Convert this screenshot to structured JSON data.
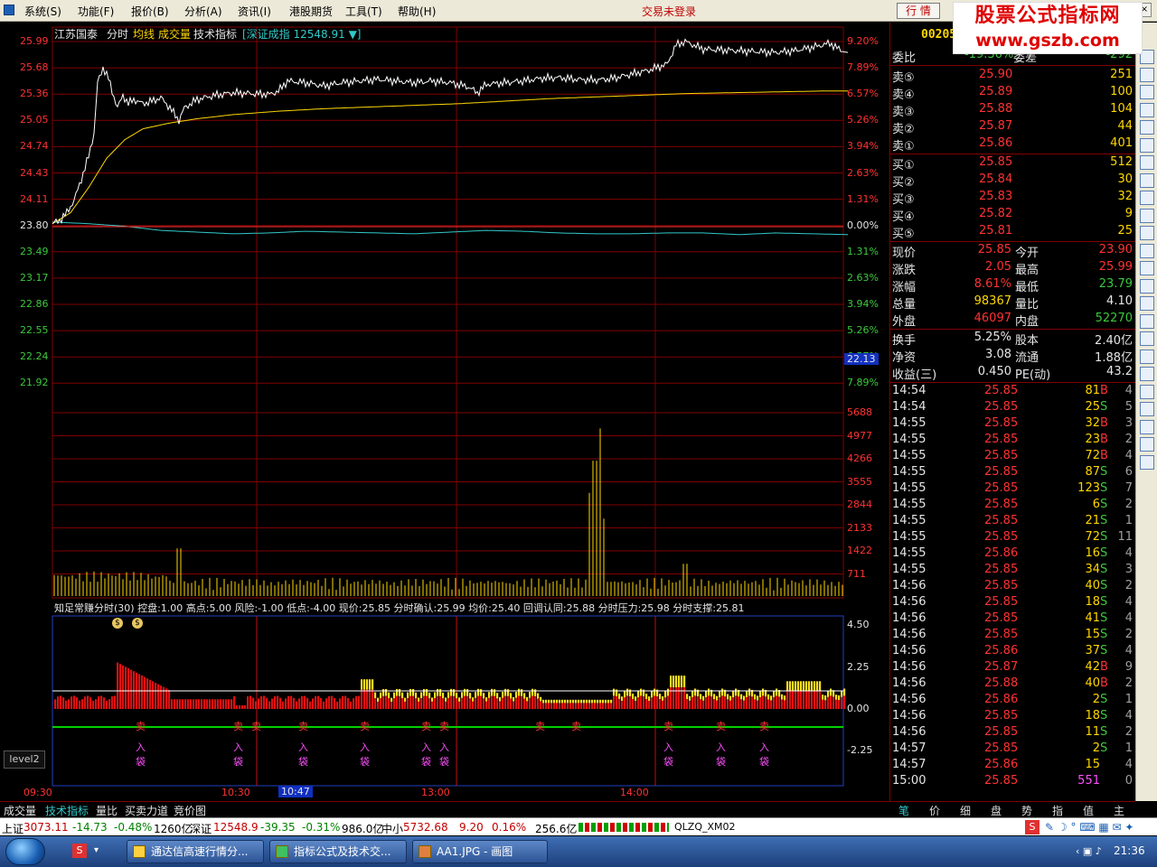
{
  "menu": {
    "items": [
      "系统(S)",
      "功能(F)",
      "报价(B)",
      "分析(A)",
      "资讯(I)",
      "港股期货",
      "工具(T)",
      "帮助(H)"
    ],
    "login_status": "交易未登录",
    "quote_button": "行 情"
  },
  "watermark": {
    "line1": "股票公式指标网",
    "line2": "www.gszb.com"
  },
  "chart_header": {
    "stock_name": "江苏国泰",
    "tabs": [
      "分时",
      "均线",
      "成交量",
      "技术指标"
    ],
    "index_label": "[深证成指 12548.91 ▼]"
  },
  "price_axis": {
    "left_prices": [
      "25.99",
      "25.68",
      "25.36",
      "25.05",
      "24.74",
      "24.43",
      "24.11",
      "23.80",
      "23.49",
      "23.17",
      "22.86",
      "22.55",
      "22.24",
      "21.92"
    ],
    "right_pcts": [
      "9.20%",
      "7.89%",
      "6.57%",
      "5.26%",
      "3.94%",
      "2.63%",
      "1.31%",
      "0.00%",
      "1.31%",
      "2.63%",
      "3.94%",
      "5.26%",
      "6.57%",
      "7.89%"
    ],
    "cursor_price": "22.13"
  },
  "volume_axis": {
    "labels": [
      "5688",
      "4977",
      "4266",
      "3555",
      "2844",
      "2133",
      "1422",
      "711"
    ]
  },
  "indicator": {
    "header": "知足常赚分时(30)  控盘:1.00  高点:5.00  风险:-1.00  低点:-4.00  现价:25.85  分时确认:25.99  均价:25.40  回调认同:25.88  分时压力:25.98  分时支撑:25.81",
    "axis": [
      "4.50",
      "2.25",
      "0.00",
      "-2.25"
    ],
    "signal_word_sell": "卖",
    "signal_word_in": "入",
    "signal_word_bag": "袋",
    "level_button": "level2"
  },
  "time_axis": {
    "labels": [
      "09:30",
      "10:30",
      "13:00",
      "14:00"
    ],
    "cursor_time": "10:47"
  },
  "panel": {
    "code_partial": "00205",
    "weibi": {
      "label": "委比",
      "value": "-19.36%",
      "label2": "委差",
      "value2": "-292"
    },
    "sells": [
      {
        "label": "卖⑤",
        "price": "25.90",
        "vol": "251"
      },
      {
        "label": "卖④",
        "price": "25.89",
        "vol": "100"
      },
      {
        "label": "卖③",
        "price": "25.88",
        "vol": "104"
      },
      {
        "label": "卖②",
        "price": "25.87",
        "vol": "44"
      },
      {
        "label": "卖①",
        "price": "25.86",
        "vol": "401"
      }
    ],
    "buys": [
      {
        "label": "买①",
        "price": "25.85",
        "vol": "512"
      },
      {
        "label": "买②",
        "price": "25.84",
        "vol": "30"
      },
      {
        "label": "买③",
        "price": "25.83",
        "vol": "32"
      },
      {
        "label": "买④",
        "price": "25.82",
        "vol": "9"
      },
      {
        "label": "买⑤",
        "price": "25.81",
        "vol": "25"
      }
    ],
    "stats1": [
      {
        "l1": "现价",
        "v1": "25.85",
        "l2": "今开",
        "v2": "23.90",
        "c1": "red",
        "c2": "red"
      },
      {
        "l1": "涨跌",
        "v1": "2.05",
        "l2": "最高",
        "v2": "25.99",
        "c1": "red",
        "c2": "red"
      },
      {
        "l1": "涨幅",
        "v1": "8.61%",
        "l2": "最低",
        "v2": "23.79",
        "c1": "red",
        "c2": "green"
      },
      {
        "l1": "总量",
        "v1": "98367",
        "l2": "量比",
        "v2": "4.10",
        "c1": "yellow",
        "c2": "white"
      },
      {
        "l1": "外盘",
        "v1": "46097",
        "l2": "内盘",
        "v2": "52270",
        "c1": "red",
        "c2": "green"
      }
    ],
    "stats2": [
      {
        "l1": "换手",
        "v1": "5.25%",
        "l2": "股本",
        "v2": "2.40亿"
      },
      {
        "l1": "净资",
        "v1": "3.08",
        "l2": "流通",
        "v2": "1.88亿"
      },
      {
        "l1": "收益(三)",
        "v1": "0.450",
        "l2": "PE(动)",
        "v2": "43.2"
      }
    ],
    "ticks": [
      {
        "t": "14:54",
        "p": "25.85",
        "v": "81",
        "s": "B",
        "n": "4"
      },
      {
        "t": "14:54",
        "p": "25.85",
        "v": "25",
        "s": "S",
        "n": "5"
      },
      {
        "t": "14:55",
        "p": "25.85",
        "v": "32",
        "s": "B",
        "n": "3"
      },
      {
        "t": "14:55",
        "p": "25.85",
        "v": "23",
        "s": "B",
        "n": "2"
      },
      {
        "t": "14:55",
        "p": "25.85",
        "v": "72",
        "s": "B",
        "n": "4"
      },
      {
        "t": "14:55",
        "p": "25.85",
        "v": "87",
        "s": "S",
        "n": "6"
      },
      {
        "t": "14:55",
        "p": "25.85",
        "v": "123",
        "s": "S",
        "n": "7"
      },
      {
        "t": "14:55",
        "p": "25.85",
        "v": "6",
        "s": "S",
        "n": "2"
      },
      {
        "t": "14:55",
        "p": "25.85",
        "v": "21",
        "s": "S",
        "n": "1"
      },
      {
        "t": "14:55",
        "p": "25.85",
        "v": "72",
        "s": "S",
        "n": "11"
      },
      {
        "t": "14:55",
        "p": "25.86",
        "v": "16",
        "s": "S",
        "n": "4"
      },
      {
        "t": "14:55",
        "p": "25.85",
        "v": "34",
        "s": "S",
        "n": "3"
      },
      {
        "t": "14:56",
        "p": "25.85",
        "v": "40",
        "s": "S",
        "n": "2"
      },
      {
        "t": "14:56",
        "p": "25.85",
        "v": "18",
        "s": "S",
        "n": "4"
      },
      {
        "t": "14:56",
        "p": "25.85",
        "v": "41",
        "s": "S",
        "n": "4"
      },
      {
        "t": "14:56",
        "p": "25.85",
        "v": "15",
        "s": "S",
        "n": "2"
      },
      {
        "t": "14:56",
        "p": "25.86",
        "v": "37",
        "s": "S",
        "n": "4"
      },
      {
        "t": "14:56",
        "p": "25.87",
        "v": "42",
        "s": "B",
        "n": "9"
      },
      {
        "t": "14:56",
        "p": "25.88",
        "v": "40",
        "s": "B",
        "n": "2"
      },
      {
        "t": "14:56",
        "p": "25.86",
        "v": "2",
        "s": "S",
        "n": "1"
      },
      {
        "t": "14:56",
        "p": "25.85",
        "v": "18",
        "s": "S",
        "n": "4"
      },
      {
        "t": "14:56",
        "p": "25.85",
        "v": "11",
        "s": "S",
        "n": "2"
      },
      {
        "t": "14:57",
        "p": "25.85",
        "v": "2",
        "s": "S",
        "n": "1"
      },
      {
        "t": "14:57",
        "p": "25.86",
        "v": "15",
        "s": "",
        "n": "4"
      },
      {
        "t": "15:00",
        "p": "25.85",
        "v": "551",
        "s": "",
        "n": "0"
      }
    ]
  },
  "bottom_tabs": [
    "成交量",
    "技术指标",
    "量比",
    "买卖力道",
    "竞价图"
  ],
  "right_tabs": [
    "笔",
    "价",
    "细",
    "盘",
    "势",
    "指",
    "值",
    "主"
  ],
  "status_bar": {
    "sh_label": "上证",
    "sh_val": "3073.11",
    "sh_chg": "-14.73",
    "sh_pct": "-0.48%",
    "sh_amt": "1260亿",
    "sz_label": "深证",
    "sz_val": "12548.9",
    "sz_chg": "-39.35",
    "sz_pct": "-0.31%",
    "sz_amt": "986.0亿",
    "zx_label": "中小",
    "zx_val": "5732.68",
    "zx_chg": "9.20",
    "zx_pct": "0.16%",
    "zx_amt": "256.6亿",
    "server": "QLZQ_XM02"
  },
  "taskbar": {
    "items": [
      "通达信高速行情分...",
      "指标公式及技术交...",
      "AA1.JPG - 画图"
    ],
    "clock": "21:36"
  },
  "chart_data": {
    "type": "line",
    "x_range": [
      "09:30",
      "15:00"
    ],
    "price_ylim": [
      21.92,
      25.99
    ],
    "prev_close": 23.8,
    "series": [
      {
        "name": "现价",
        "color": "#ffffff",
        "points": [
          [
            0,
            23.82
          ],
          [
            8,
            23.86
          ],
          [
            16,
            23.95
          ],
          [
            24,
            24.1
          ],
          [
            32,
            24.35
          ],
          [
            40,
            24.62
          ],
          [
            46,
            24.9
          ],
          [
            50,
            25.5
          ],
          [
            56,
            25.68
          ],
          [
            62,
            25.55
          ],
          [
            66,
            25.4
          ],
          [
            72,
            25.2
          ],
          [
            78,
            25.35
          ],
          [
            84,
            25.25
          ],
          [
            90,
            25.3
          ],
          [
            100,
            25.25
          ],
          [
            110,
            25.28
          ],
          [
            120,
            25.32
          ],
          [
            130,
            25.2
          ],
          [
            140,
            25.05
          ],
          [
            146,
            25.2
          ],
          [
            160,
            25.3
          ],
          [
            180,
            25.35
          ],
          [
            200,
            25.38
          ],
          [
            220,
            25.37
          ],
          [
            240,
            25.36
          ],
          [
            250,
            25.4
          ],
          [
            260,
            25.52
          ],
          [
            280,
            25.5
          ],
          [
            300,
            25.46
          ],
          [
            320,
            25.5
          ],
          [
            340,
            25.52
          ],
          [
            360,
            25.54
          ],
          [
            380,
            25.52
          ],
          [
            400,
            25.5
          ],
          [
            420,
            25.52
          ],
          [
            440,
            25.5
          ],
          [
            460,
            25.45
          ],
          [
            470,
            25.38
          ],
          [
            480,
            25.48
          ],
          [
            500,
            25.5
          ],
          [
            520,
            25.52
          ],
          [
            540,
            25.55
          ],
          [
            560,
            25.56
          ],
          [
            580,
            25.54
          ],
          [
            600,
            25.53
          ],
          [
            620,
            25.55
          ],
          [
            640,
            25.6
          ],
          [
            660,
            25.65
          ],
          [
            680,
            25.72
          ],
          [
            690,
            25.95
          ],
          [
            700,
            25.99
          ],
          [
            720,
            25.9
          ],
          [
            760,
            25.88
          ],
          [
            800,
            25.86
          ],
          [
            820,
            25.88
          ],
          [
            840,
            25.92
          ],
          [
            860,
            25.97
          ],
          [
            870,
            25.9
          ],
          [
            880,
            25.86
          ]
        ]
      },
      {
        "name": "均价",
        "color": "#ffd700",
        "points": [
          [
            0,
            23.82
          ],
          [
            20,
            23.95
          ],
          [
            40,
            24.25
          ],
          [
            60,
            24.6
          ],
          [
            80,
            24.82
          ],
          [
            100,
            24.95
          ],
          [
            130,
            25.02
          ],
          [
            160,
            25.07
          ],
          [
            200,
            25.12
          ],
          [
            250,
            25.16
          ],
          [
            300,
            25.19
          ],
          [
            350,
            25.21
          ],
          [
            400,
            25.23
          ],
          [
            450,
            25.25
          ],
          [
            500,
            25.28
          ],
          [
            550,
            25.31
          ],
          [
            600,
            25.33
          ],
          [
            650,
            25.35
          ],
          [
            700,
            25.37
          ],
          [
            750,
            25.38
          ],
          [
            800,
            25.39
          ],
          [
            850,
            25.4
          ],
          [
            880,
            25.4
          ]
        ]
      },
      {
        "name": "深证成指",
        "color": "#32c8c8",
        "points": [
          [
            0,
            23.84
          ],
          [
            40,
            23.82
          ],
          [
            80,
            23.79
          ],
          [
            120,
            23.74
          ],
          [
            160,
            23.72
          ],
          [
            200,
            23.7
          ],
          [
            240,
            23.71
          ],
          [
            280,
            23.73
          ],
          [
            320,
            23.72
          ],
          [
            360,
            23.71
          ],
          [
            400,
            23.7
          ],
          [
            440,
            23.72
          ],
          [
            480,
            23.74
          ],
          [
            520,
            23.73
          ],
          [
            560,
            23.71
          ],
          [
            600,
            23.7
          ],
          [
            640,
            23.7
          ],
          [
            680,
            23.71
          ],
          [
            720,
            23.71
          ],
          [
            760,
            23.69
          ],
          [
            800,
            23.71
          ],
          [
            840,
            23.7
          ],
          [
            880,
            23.69
          ]
        ]
      }
    ],
    "volume_ylim": [
      0,
      5688
    ],
    "volume_peaks": [
      [
        595,
        3200
      ],
      [
        600,
        4200
      ],
      [
        605,
        5200
      ],
      [
        610,
        2400
      ],
      [
        140,
        1480
      ],
      [
        700,
        1000
      ]
    ]
  }
}
